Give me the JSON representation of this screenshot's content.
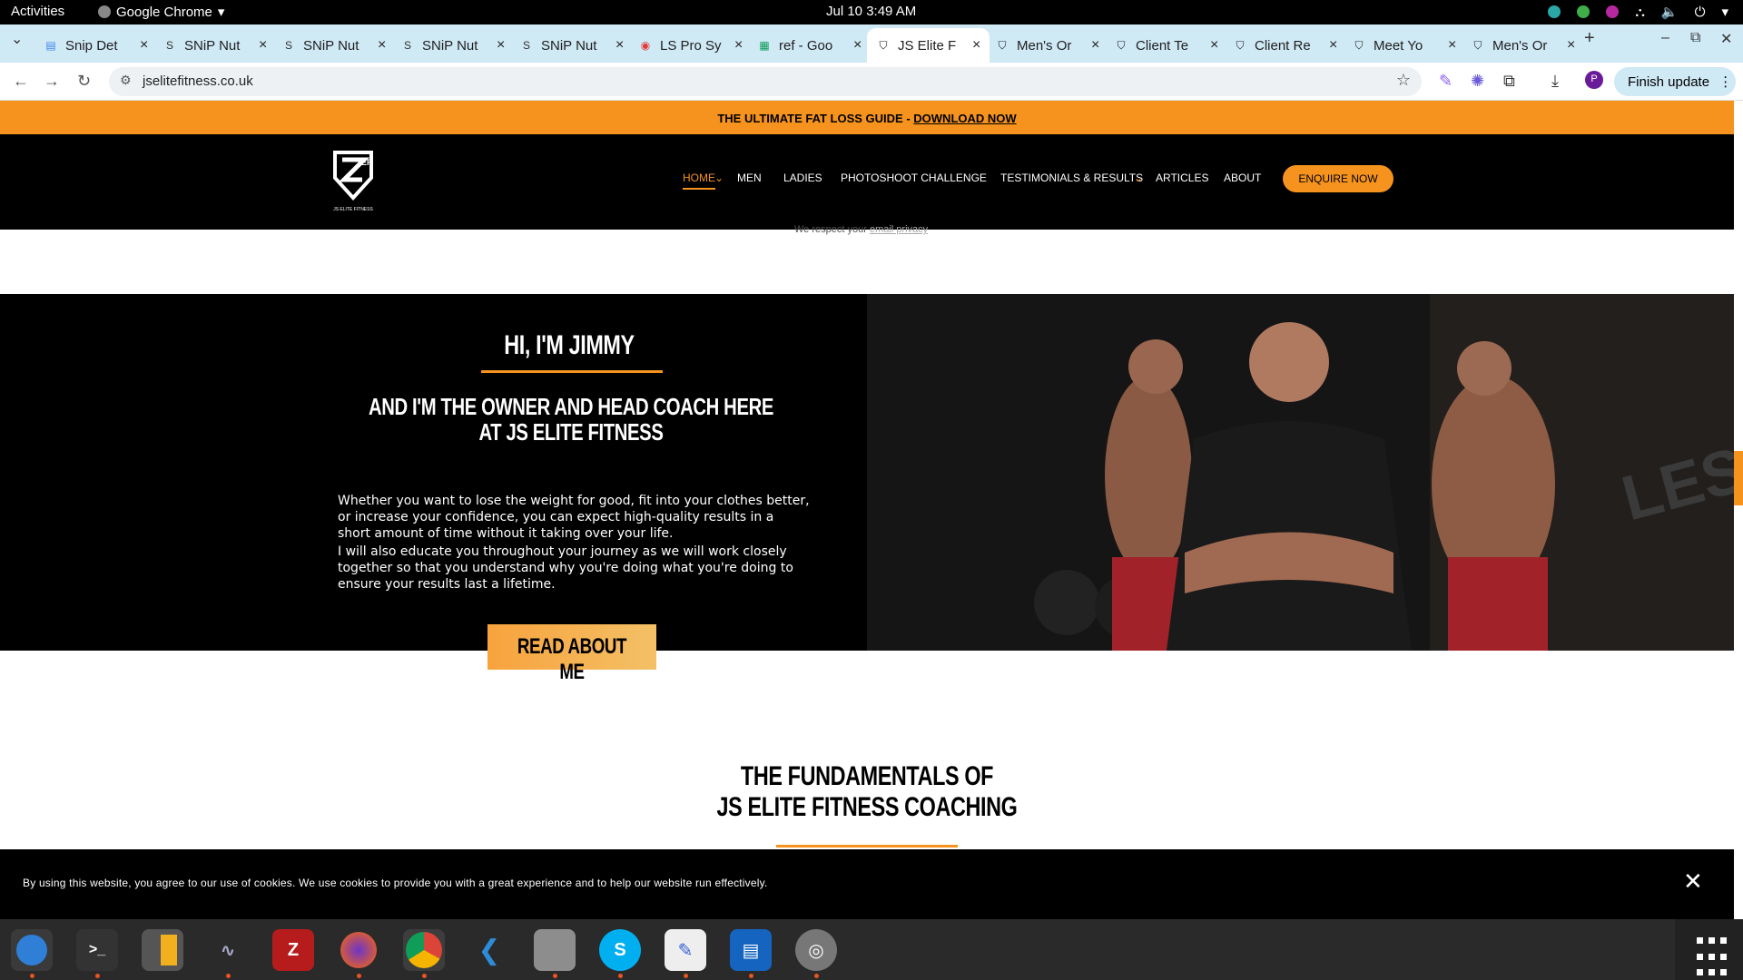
{
  "system": {
    "activities": "Activities",
    "app_name": "Google Chrome",
    "clock": "Jul 10  3:49 AM"
  },
  "tabs": [
    {
      "title": "Snip Det",
      "icon": "docs-icon",
      "active": false
    },
    {
      "title": "SNiP Nut",
      "icon": "snip-icon",
      "active": false
    },
    {
      "title": "SNiP Nut",
      "icon": "snip-icon",
      "active": false
    },
    {
      "title": "SNiP Nut",
      "icon": "snip-icon",
      "active": false
    },
    {
      "title": "SNiP Nut",
      "icon": "snip-icon",
      "active": false
    },
    {
      "title": "LS Pro Sy",
      "icon": "ls-icon",
      "active": false
    },
    {
      "title": "ref - Goo",
      "icon": "sheets-icon",
      "active": false
    },
    {
      "title": "JS Elite F",
      "icon": "jsef-icon",
      "active": true
    },
    {
      "title": "Men's Or",
      "icon": "jsef-icon",
      "active": false
    },
    {
      "title": "Client Te",
      "icon": "jsef-icon",
      "active": false
    },
    {
      "title": "Client Re",
      "icon": "jsef-icon",
      "active": false
    },
    {
      "title": "Meet Yo",
      "icon": "jsef-icon",
      "active": false
    },
    {
      "title": "Men's Or",
      "icon": "jsef-icon",
      "active": false
    }
  ],
  "browser": {
    "url": "jselitefitness.co.uk",
    "finish_update": "Finish update",
    "profile_initial": "P"
  },
  "site": {
    "promo_text": "THE ULTIMATE FAT LOSS GUIDE - ",
    "promo_link": "DOWNLOAD NOW",
    "logo_caption": "JS ELITE FITNESS",
    "nav": [
      "HOME",
      "MEN",
      "LADIES",
      "PHOTOSHOOT CHALLENGE",
      "TESTIMONIALS & RESULTS",
      "ARTICLES",
      "ABOUT"
    ],
    "enquire": "ENQUIRE NOW",
    "privacy_prefix": "We respect your ",
    "privacy_link": "email privacy",
    "hero": {
      "title": "HI, I'M JIMMY",
      "subtitle": "AND I'M THE OWNER AND HEAD COACH HERE AT JS ELITE FITNESS",
      "p1": "Whether you want to lose the weight for good, fit into your clothes better, or increase your confidence, you can expect high-quality results in a short amount of time without it taking over your life.",
      "p2": "I will also educate you throughout your journey as we will work closely together so that you understand why you're doing what you're doing to ensure your results last a lifetime.",
      "button": "READ ABOUT ME"
    },
    "fundamentals_line1": "THE FUNDAMENTALS OF",
    "fundamentals_line2": "JS ELITE FITNESS COACHING",
    "cookie_text": "By using this website, you agree to our use of cookies. We use cookies to provide you with a great experience and to help our website run effectively."
  },
  "colors": {
    "accent": "#f5931e",
    "tabstrip": "#cfe9f5"
  }
}
